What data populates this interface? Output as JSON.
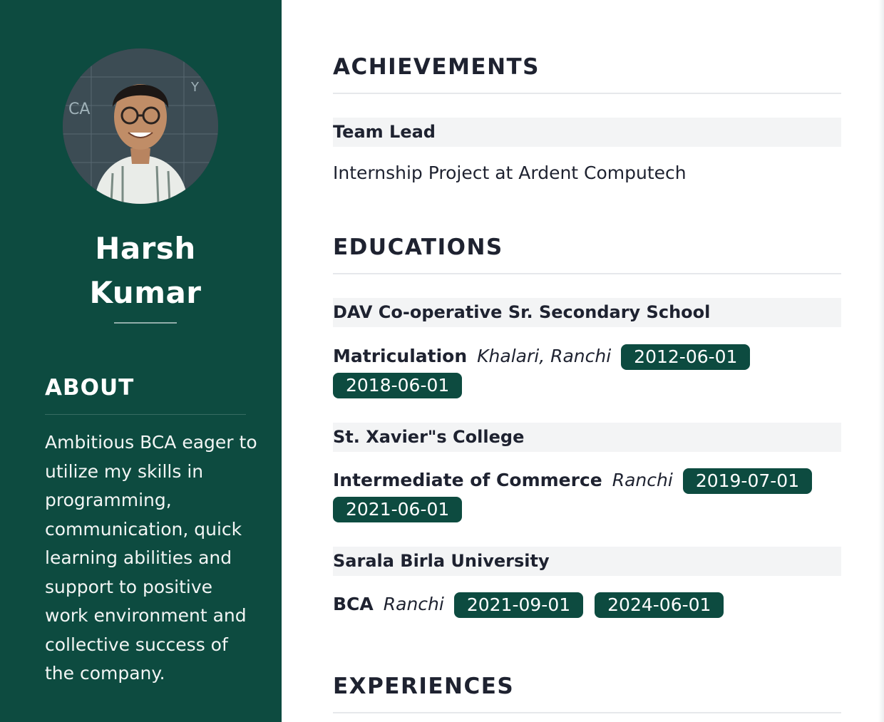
{
  "profile": {
    "first_name": "Harsh",
    "last_name": "Kumar",
    "photo_alt": "profile-photo"
  },
  "about": {
    "title": "ABOUT",
    "text": "Ambitious BCA eager to utilize my skills in programming, communication, quick learning abilities and support to positive work environment and collective success of the company."
  },
  "achievements": {
    "title": "ACHIEVEMENTS",
    "items": [
      {
        "name": "Team Lead",
        "description": "Internship Project at Ardent Computech"
      }
    ]
  },
  "educations": {
    "title": "EDUCATIONS",
    "items": [
      {
        "school": "DAV Co-operative Sr. Secondary School",
        "degree": "Matriculation",
        "place": "Khalari, Ranchi",
        "start": "2012-06-01",
        "end": "2018-06-01"
      },
      {
        "school": "St. Xavier\"s College",
        "degree": "Intermediate of Commerce",
        "place": "Ranchi",
        "start": "2019-07-01",
        "end": "2021-06-01"
      },
      {
        "school": "Sarala Birla University",
        "degree": "BCA",
        "place": "Ranchi",
        "start": "2021-09-01",
        "end": "2024-06-01"
      }
    ]
  },
  "experiences": {
    "title": "EXPERIENCES"
  },
  "colors": {
    "sidebar": "#0d4b40",
    "badge": "#0d4b40",
    "heading": "#1e2230",
    "item_bar": "#f3f4f5"
  }
}
